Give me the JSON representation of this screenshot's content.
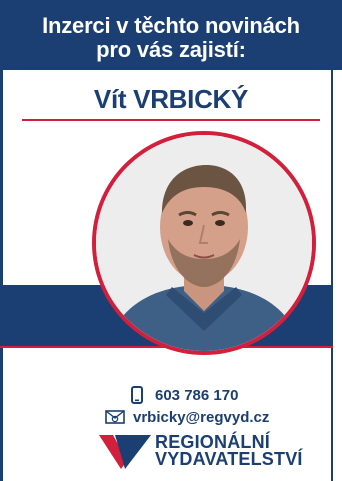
{
  "header": {
    "line1": "Inzerci v těchto novinách",
    "line2": "pro vás zajistí:"
  },
  "person": {
    "name": "Vít VRBICKÝ"
  },
  "contact": {
    "phone": "603 786 170",
    "email": "vrbicky@regvyd.cz",
    "phone_icon": "mobile-phone-icon",
    "email_icon": "envelope-at-icon"
  },
  "logo": {
    "line1": "REGIONÁLNÍ",
    "line2": "VYDAVATELSTVÍ"
  },
  "colors": {
    "navy": "#1b3f73",
    "red": "#d21f3c",
    "white": "#ffffff"
  }
}
